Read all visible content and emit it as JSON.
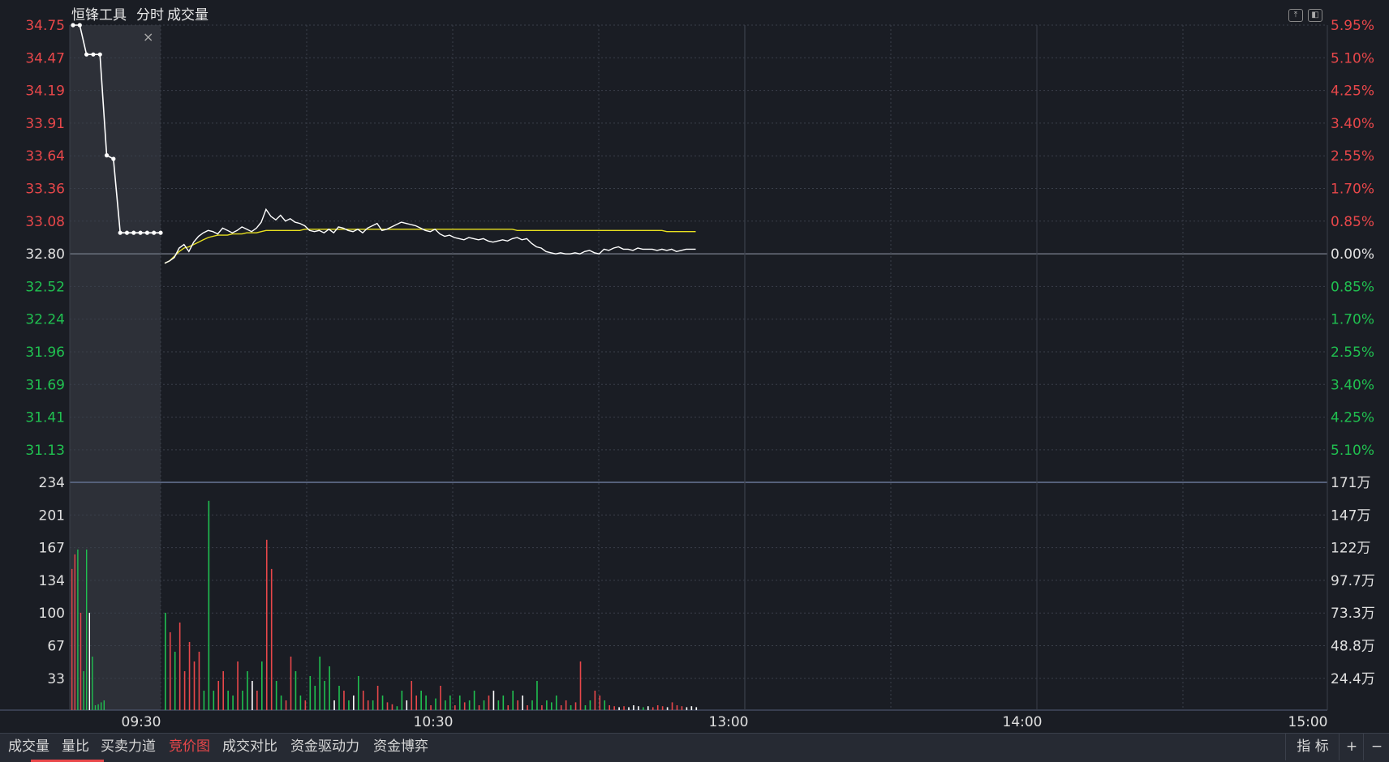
{
  "header": {
    "stock_name": "恒锋工具",
    "mode_label": "分时",
    "indicator_label": "成交量"
  },
  "icons": {
    "expand": "expand-up-icon",
    "panel": "panel-toggle-icon",
    "close": "close-icon"
  },
  "colors": {
    "up": "#e8474a",
    "down": "#20c050",
    "price_line": "#ffffff",
    "avg_line": "#e8e020",
    "grid": "#3a3f4a",
    "auction_bg": "#2d3038"
  },
  "chart_data": {
    "type": "line",
    "price_axis": {
      "left_labels": [
        "34.75",
        "34.47",
        "34.19",
        "33.91",
        "33.64",
        "33.36",
        "33.08",
        "32.80",
        "32.52",
        "32.24",
        "31.96",
        "31.69",
        "31.41",
        "31.13"
      ],
      "right_labels": [
        "5.95%",
        "5.10%",
        "4.25%",
        "3.40%",
        "2.55%",
        "1.70%",
        "0.85%",
        "0.00%",
        "0.85%",
        "1.70%",
        "2.55%",
        "3.40%",
        "4.25%",
        "5.10%"
      ],
      "reference_price": 32.8,
      "ylim": [
        31.13,
        34.75
      ]
    },
    "volume_axis": {
      "left_labels": [
        "234",
        "201",
        "167",
        "134",
        "100",
        "67",
        "33"
      ],
      "right_labels": [
        "171万",
        "147万",
        "122万",
        "97.7万",
        "73.3万",
        "48.8万",
        "24.4万"
      ],
      "ylim": [
        0,
        234
      ]
    },
    "time_labels": [
      "09:30",
      "10:30",
      "13:00",
      "14:00",
      "15:00"
    ],
    "auction_prices": [
      34.75,
      34.75,
      34.5,
      34.5,
      34.5,
      33.64,
      33.61,
      32.98,
      32.98,
      32.98,
      32.98,
      32.98,
      32.98,
      32.98
    ],
    "auction_volumes": [
      {
        "v": 145,
        "c": "up"
      },
      {
        "v": 160,
        "c": "up"
      },
      {
        "v": 165,
        "c": "down"
      },
      {
        "v": 100,
        "c": "up"
      },
      {
        "v": 40,
        "c": "down"
      },
      {
        "v": 165,
        "c": "down"
      },
      {
        "v": 100,
        "c": "flat"
      },
      {
        "v": 55,
        "c": "down"
      },
      {
        "v": 5,
        "c": "down"
      },
      {
        "v": 6,
        "c": "down"
      },
      {
        "v": 8,
        "c": "down"
      },
      {
        "v": 10,
        "c": "down"
      }
    ],
    "price_series": [
      32.72,
      32.74,
      32.77,
      32.85,
      32.88,
      32.82,
      32.9,
      32.95,
      32.98,
      33.0,
      32.99,
      32.97,
      33.02,
      33.0,
      32.98,
      33.0,
      33.03,
      33.01,
      32.99,
      33.02,
      33.07,
      33.18,
      33.12,
      33.09,
      33.13,
      33.08,
      33.1,
      33.07,
      33.06,
      33.04,
      33.0,
      32.99,
      33.0,
      32.98,
      33.01,
      32.98,
      33.03,
      33.02,
      33.0,
      32.99,
      33.01,
      32.98,
      33.02,
      33.04,
      33.06,
      33.0,
      33.01,
      33.03,
      33.05,
      33.07,
      33.06,
      33.05,
      33.04,
      33.02,
      33.0,
      32.99,
      33.01,
      32.97,
      32.95,
      32.96,
      32.94,
      32.93,
      32.92,
      32.94,
      32.93,
      32.92,
      32.93,
      32.91,
      32.9,
      32.91,
      32.92,
      32.91,
      32.93,
      32.94,
      32.92,
      32.93,
      32.89,
      32.86,
      32.85,
      32.82,
      32.81,
      32.8,
      32.81,
      32.8,
      32.8,
      32.81,
      32.8,
      32.82,
      32.83,
      32.81,
      32.8,
      32.84,
      32.83,
      32.85,
      32.86,
      32.84,
      32.84,
      32.83,
      32.85,
      32.84,
      32.84,
      32.84,
      32.83,
      32.84,
      32.83,
      32.84,
      32.82,
      32.83,
      32.84,
      32.84,
      32.84
    ],
    "avg_series": [
      32.72,
      32.74,
      32.78,
      32.82,
      32.85,
      32.86,
      32.88,
      32.9,
      32.92,
      32.94,
      32.95,
      32.96,
      32.96,
      32.96,
      32.97,
      32.97,
      32.97,
      32.98,
      32.98,
      32.98,
      32.99,
      33.0,
      33.0,
      33.0,
      33.0,
      33.0,
      33.0,
      33.0,
      33.0,
      33.01,
      33.01,
      33.01,
      33.01,
      33.01,
      33.01,
      33.01,
      33.01,
      33.01,
      33.01,
      33.01,
      33.01,
      33.01,
      33.01,
      33.01,
      33.01,
      33.01,
      33.01,
      33.01,
      33.01,
      33.01,
      33.01,
      33.01,
      33.01,
      33.01,
      33.01,
      33.01,
      33.01,
      33.01,
      33.01,
      33.01,
      33.01,
      33.01,
      33.01,
      33.01,
      33.01,
      33.01,
      33.01,
      33.01,
      33.01,
      33.01,
      33.01,
      33.01,
      33.01,
      33.0,
      33.0,
      33.0,
      33.0,
      33.0,
      33.0,
      33.0,
      33.0,
      33.0,
      33.0,
      33.0,
      33.0,
      33.0,
      33.0,
      33.0,
      33.0,
      33.0,
      33.0,
      33.0,
      33.0,
      33.0,
      33.0,
      33.0,
      33.0,
      33.0,
      33.0,
      33.0,
      33.0,
      33.0,
      33.0,
      33.0,
      32.99,
      32.99,
      32.99,
      32.99,
      32.99,
      32.99,
      32.99
    ],
    "volumes": [
      {
        "v": 100,
        "c": "down"
      },
      {
        "v": 80,
        "c": "up"
      },
      {
        "v": 60,
        "c": "down"
      },
      {
        "v": 90,
        "c": "up"
      },
      {
        "v": 40,
        "c": "up"
      },
      {
        "v": 70,
        "c": "up"
      },
      {
        "v": 50,
        "c": "up"
      },
      {
        "v": 60,
        "c": "up"
      },
      {
        "v": 20,
        "c": "down"
      },
      {
        "v": 215,
        "c": "down"
      },
      {
        "v": 20,
        "c": "down"
      },
      {
        "v": 30,
        "c": "up"
      },
      {
        "v": 40,
        "c": "up"
      },
      {
        "v": 20,
        "c": "down"
      },
      {
        "v": 15,
        "c": "down"
      },
      {
        "v": 50,
        "c": "up"
      },
      {
        "v": 20,
        "c": "down"
      },
      {
        "v": 40,
        "c": "down"
      },
      {
        "v": 30,
        "c": "flat"
      },
      {
        "v": 20,
        "c": "up"
      },
      {
        "v": 50,
        "c": "down"
      },
      {
        "v": 175,
        "c": "up"
      },
      {
        "v": 145,
        "c": "up"
      },
      {
        "v": 30,
        "c": "down"
      },
      {
        "v": 15,
        "c": "down"
      },
      {
        "v": 10,
        "c": "up"
      },
      {
        "v": 55,
        "c": "up"
      },
      {
        "v": 40,
        "c": "down"
      },
      {
        "v": 15,
        "c": "down"
      },
      {
        "v": 10,
        "c": "up"
      },
      {
        "v": 35,
        "c": "down"
      },
      {
        "v": 25,
        "c": "down"
      },
      {
        "v": 55,
        "c": "down"
      },
      {
        "v": 30,
        "c": "down"
      },
      {
        "v": 45,
        "c": "down"
      },
      {
        "v": 10,
        "c": "flat"
      },
      {
        "v": 25,
        "c": "down"
      },
      {
        "v": 20,
        "c": "up"
      },
      {
        "v": 10,
        "c": "down"
      },
      {
        "v": 15,
        "c": "flat"
      },
      {
        "v": 35,
        "c": "down"
      },
      {
        "v": 20,
        "c": "up"
      },
      {
        "v": 10,
        "c": "up"
      },
      {
        "v": 10,
        "c": "down"
      },
      {
        "v": 25,
        "c": "up"
      },
      {
        "v": 15,
        "c": "down"
      },
      {
        "v": 8,
        "c": "up"
      },
      {
        "v": 6,
        "c": "up"
      },
      {
        "v": 4,
        "c": "down"
      },
      {
        "v": 20,
        "c": "down"
      },
      {
        "v": 10,
        "c": "flat"
      },
      {
        "v": 30,
        "c": "up"
      },
      {
        "v": 15,
        "c": "up"
      },
      {
        "v": 20,
        "c": "down"
      },
      {
        "v": 15,
        "c": "down"
      },
      {
        "v": 5,
        "c": "up"
      },
      {
        "v": 12,
        "c": "down"
      },
      {
        "v": 25,
        "c": "up"
      },
      {
        "v": 10,
        "c": "down"
      },
      {
        "v": 15,
        "c": "down"
      },
      {
        "v": 5,
        "c": "up"
      },
      {
        "v": 15,
        "c": "down"
      },
      {
        "v": 8,
        "c": "up"
      },
      {
        "v": 10,
        "c": "down"
      },
      {
        "v": 20,
        "c": "down"
      },
      {
        "v": 5,
        "c": "up"
      },
      {
        "v": 10,
        "c": "down"
      },
      {
        "v": 15,
        "c": "up"
      },
      {
        "v": 20,
        "c": "flat"
      },
      {
        "v": 10,
        "c": "down"
      },
      {
        "v": 15,
        "c": "down"
      },
      {
        "v": 5,
        "c": "up"
      },
      {
        "v": 20,
        "c": "down"
      },
      {
        "v": 10,
        "c": "up"
      },
      {
        "v": 15,
        "c": "flat"
      },
      {
        "v": 5,
        "c": "up"
      },
      {
        "v": 10,
        "c": "down"
      },
      {
        "v": 30,
        "c": "down"
      },
      {
        "v": 5,
        "c": "up"
      },
      {
        "v": 10,
        "c": "down"
      },
      {
        "v": 8,
        "c": "down"
      },
      {
        "v": 15,
        "c": "down"
      },
      {
        "v": 5,
        "c": "up"
      },
      {
        "v": 10,
        "c": "up"
      },
      {
        "v": 5,
        "c": "down"
      },
      {
        "v": 8,
        "c": "up"
      },
      {
        "v": 50,
        "c": "up"
      },
      {
        "v": 5,
        "c": "down"
      },
      {
        "v": 10,
        "c": "down"
      },
      {
        "v": 20,
        "c": "up"
      },
      {
        "v": 15,
        "c": "up"
      },
      {
        "v": 10,
        "c": "down"
      },
      {
        "v": 5,
        "c": "up"
      },
      {
        "v": 4,
        "c": "up"
      },
      {
        "v": 3,
        "c": "flat"
      },
      {
        "v": 4,
        "c": "up"
      },
      {
        "v": 3,
        "c": "flat"
      },
      {
        "v": 5,
        "c": "flat"
      },
      {
        "v": 4,
        "c": "flat"
      },
      {
        "v": 3,
        "c": "down"
      },
      {
        "v": 4,
        "c": "flat"
      },
      {
        "v": 3,
        "c": "up"
      },
      {
        "v": 5,
        "c": "up"
      },
      {
        "v": 4,
        "c": "up"
      },
      {
        "v": 3,
        "c": "flat"
      },
      {
        "v": 8,
        "c": "up"
      },
      {
        "v": 5,
        "c": "up"
      },
      {
        "v": 4,
        "c": "up"
      },
      {
        "v": 3,
        "c": "flat"
      },
      {
        "v": 4,
        "c": "flat"
      },
      {
        "v": 3,
        "c": "flat"
      }
    ]
  },
  "tabs": [
    "成交量",
    "量比",
    "买卖力道",
    "竞价图",
    "成交对比",
    "资金驱动力",
    "资金博弈"
  ],
  "active_tab": "竞价图",
  "right_buttons": {
    "indicator": "指 标",
    "plus": "+",
    "minus": "−"
  }
}
